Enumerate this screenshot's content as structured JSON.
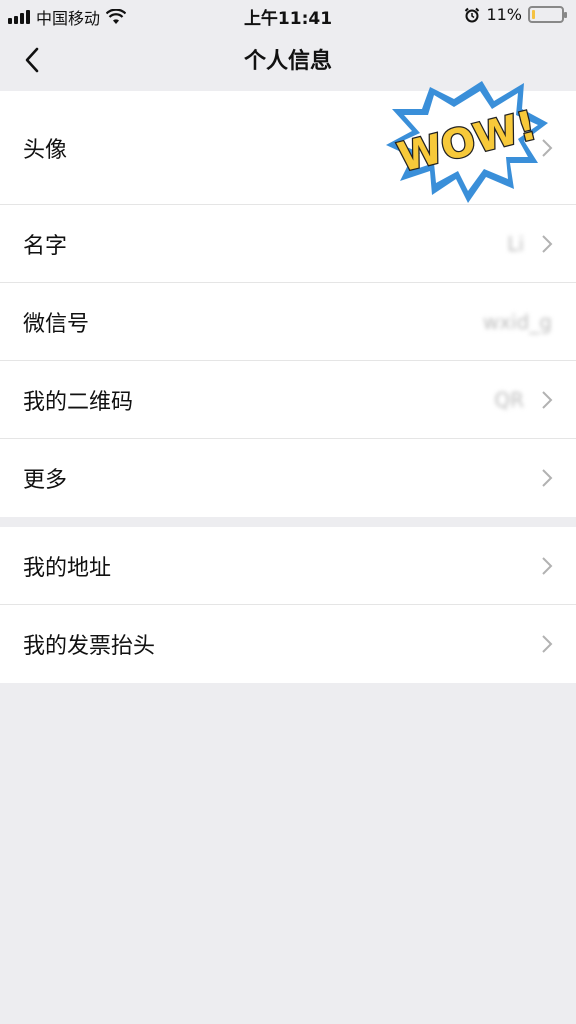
{
  "status_bar": {
    "carrier": "中国移动",
    "time": "上午11:41",
    "battery_percent": "11%",
    "battery_level": 0.11,
    "icons": [
      "signal-icon",
      "wifi-icon",
      "alarm-icon",
      "battery-icon"
    ]
  },
  "nav": {
    "title": "个人信息",
    "back_icon": "chevron-left-icon"
  },
  "group1": [
    {
      "label": "头像",
      "value": "",
      "avatar_text": "WOW!"
    },
    {
      "label": "名字",
      "value": "Li"
    },
    {
      "label": "微信号",
      "value": "wxid_g"
    },
    {
      "label": "我的二维码",
      "value": "QR"
    },
    {
      "label": "更多",
      "value": ""
    }
  ],
  "group2": [
    {
      "label": "我的地址"
    },
    {
      "label": "我的发票抬头"
    }
  ],
  "colors": {
    "background": "#ededf0",
    "cell": "#ffffff",
    "divider": "#e5e5e5",
    "chevron": "#b2b2b2",
    "wow_yellow": "#f7c93a",
    "wow_blue": "#3a8fd9"
  }
}
